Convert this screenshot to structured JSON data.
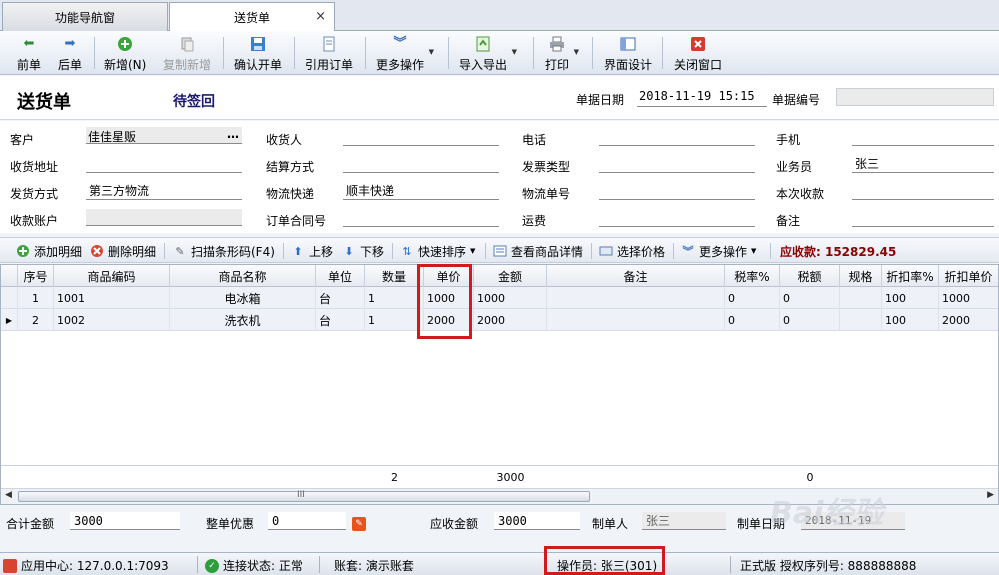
{
  "tabs": [
    {
      "label": "功能导航窗"
    },
    {
      "label": "送货单",
      "close": "×"
    }
  ],
  "toolbar": {
    "prev": "前单",
    "next": "后单",
    "new": "新增(N)",
    "copy_new": "复制新增",
    "confirm": "确认开单",
    "ref_order": "引用订单",
    "more": "更多操作",
    "import_export": "导入导出",
    "print": "打印",
    "ui_design": "界面设计",
    "close_window": "关闭窗口"
  },
  "header": {
    "title": "送货单",
    "status": "待签回",
    "date_label": "单据日期",
    "date_value": "2018-11-19 15:15",
    "no_label": "单据编号",
    "no_value": ""
  },
  "form": {
    "customer_label": "客户",
    "customer_value": "佳佳星贩",
    "customer_btn": "…",
    "receiver_label": "收货人",
    "phone_label": "电话",
    "mobile_label": "手机",
    "address_label": "收货地址",
    "settle_label": "结算方式",
    "invoice_label": "发票类型",
    "salesman_label": "业务员",
    "salesman_value": "张三",
    "ship_label": "发货方式",
    "ship_value": "第三方物流",
    "logistics_label": "物流快递",
    "logistics_value": "顺丰快递",
    "tracking_label": "物流单号",
    "collect_label": "本次收款",
    "account_label": "收款账户",
    "contract_label": "订单合同号",
    "freight_label": "运费",
    "remark_label": "备注"
  },
  "grid_toolbar": {
    "add": "添加明细",
    "delete": "删除明细",
    "scan": "扫描条形码(F4)",
    "up": "上移",
    "down": "下移",
    "sort": "快速排序",
    "detail": "查看商品详情",
    "price": "选择价格",
    "more": "更多操作",
    "due": "应收款: 152829.45"
  },
  "grid": {
    "columns": [
      "序号",
      "商品编码",
      "商品名称",
      "单位",
      "数量",
      "单价",
      "金额",
      "备注",
      "税率%",
      "税额",
      "规格",
      "折扣率%",
      "折扣单价"
    ],
    "rows": [
      {
        "no": "1",
        "code": "1001",
        "name": "电冰箱",
        "unit": "台",
        "qty": "1",
        "price": "1000",
        "amount": "1000",
        "note": "",
        "tax_rate": "0",
        "tax": "0",
        "spec": "",
        "discount": "100",
        "disc_price": "1000"
      },
      {
        "no": "2",
        "code": "1002",
        "name": "洗衣机",
        "unit": "台",
        "qty": "1",
        "price": "2000",
        "amount": "2000",
        "note": "",
        "tax_rate": "0",
        "tax": "0",
        "spec": "",
        "discount": "100",
        "disc_price": "2000"
      }
    ],
    "footer": {
      "qty": "2",
      "amount": "3000",
      "tax": "0"
    },
    "scroll_grip": "III"
  },
  "totals": {
    "total_label": "合计金额",
    "total_value": "3000",
    "discount_label": "整单优惠",
    "discount_value": "0",
    "receivable_label": "应收金额",
    "receivable_value": "3000",
    "maker_label": "制单人",
    "maker_value": "张三",
    "make_date_label": "制单日期",
    "make_date_value": "2018-11-19"
  },
  "statusbar": {
    "app_center": "应用中心: 127.0.0.1:7093",
    "connection": "连接状态: 正常",
    "account_set": "账套: 演示账套",
    "operator": "操作员: 张三(301)",
    "license": "正式版 授权序列号: 888888888"
  },
  "watermark": "Bai经验",
  "colors": {
    "accent_red": "#d11a1a",
    "due_red": "#8b0000",
    "status_navy": "#1b1b6e"
  }
}
